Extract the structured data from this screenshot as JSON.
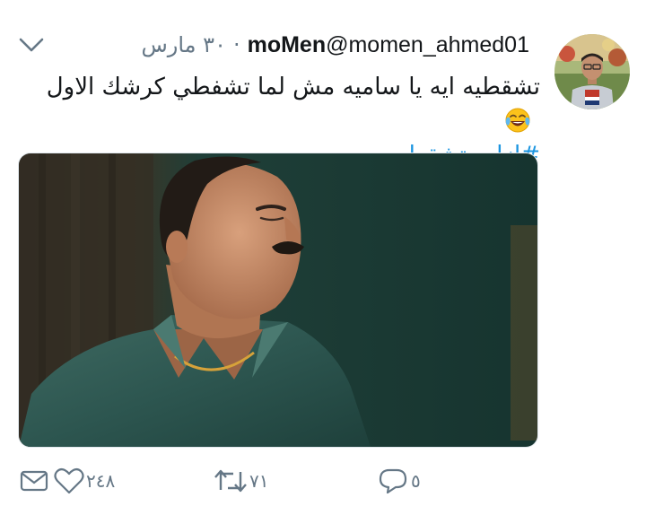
{
  "tweet": {
    "date": "٣٠ مارس",
    "separator": "·",
    "display_name": "moMen",
    "handle": "@momen_ahmed01",
    "text": "تشقطيه ايه يا ساميه مش لما تشفطي كرشك الاول",
    "emoji": "face-with-tears-of-joy",
    "hashtag": "#ازاي_تشقطيه"
  },
  "actions": {
    "likes": "٢٤٨",
    "retweets": "٧١",
    "replies": "٥"
  },
  "colors": {
    "link": "#1b95e0",
    "muted": "#657786",
    "text": "#14171a"
  }
}
